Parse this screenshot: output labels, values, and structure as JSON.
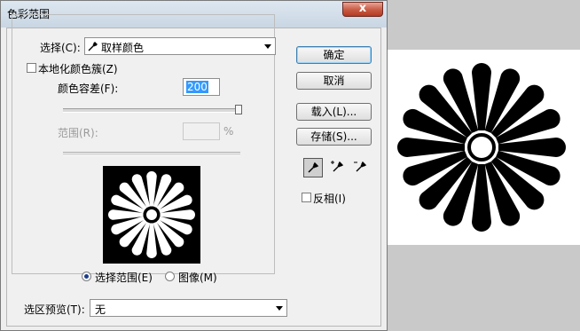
{
  "dialog": {
    "title": "色彩范围",
    "close_label": "x"
  },
  "select_row": {
    "label": "选择(C):",
    "value": "取样颜色"
  },
  "localized_clusters": {
    "label": "本地化颜色簇(Z)",
    "checked": false
  },
  "fuzziness": {
    "label": "颜色容差(F):",
    "value": "200",
    "slider_fraction": 1.0
  },
  "range": {
    "label": "范围(R):",
    "value": "",
    "unit": "%",
    "enabled": false
  },
  "preview_mode": {
    "selection_label": "选择范围(E)",
    "image_label": "图像(M)",
    "selected": "selection"
  },
  "selection_preview": {
    "label": "选区预览(T):",
    "value": "无"
  },
  "buttons": {
    "ok": "确定",
    "cancel": "取消",
    "load": "载入(L)...",
    "save": "存储(S)..."
  },
  "tools": [
    {
      "icon": "eyedropper-icon",
      "active": true
    },
    {
      "icon": "eyedropper-plus-icon",
      "active": false
    },
    {
      "icon": "eyedropper-minus-icon",
      "active": false
    }
  ],
  "invert": {
    "label": "反相(I)",
    "checked": false
  },
  "colors": {
    "selection_highlight": "#3399ff",
    "canvas_background": "#ffffff",
    "workspace_background": "#c9c9c9"
  }
}
